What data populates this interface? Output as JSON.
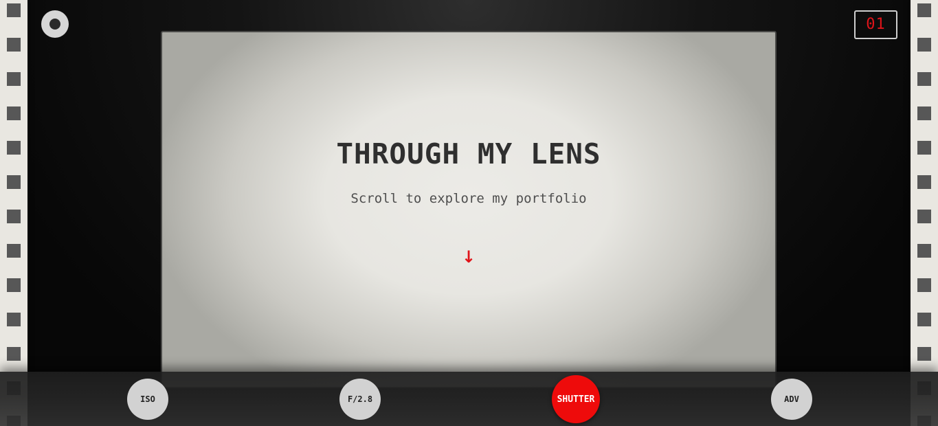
{
  "frame_counter": "01",
  "hero": {
    "title": "THROUGH MY LENS",
    "subtitle": "Scroll to explore my portfolio",
    "arrow": "↓"
  },
  "controls": {
    "iso_label": "ISO",
    "aperture_label": "F/2.8",
    "shutter_label": "SHUTTER",
    "advance_label": "ADV"
  },
  "colors": {
    "accent": "#ee0b0b",
    "film": "#e9e7e1",
    "sprocket": "#575757"
  }
}
